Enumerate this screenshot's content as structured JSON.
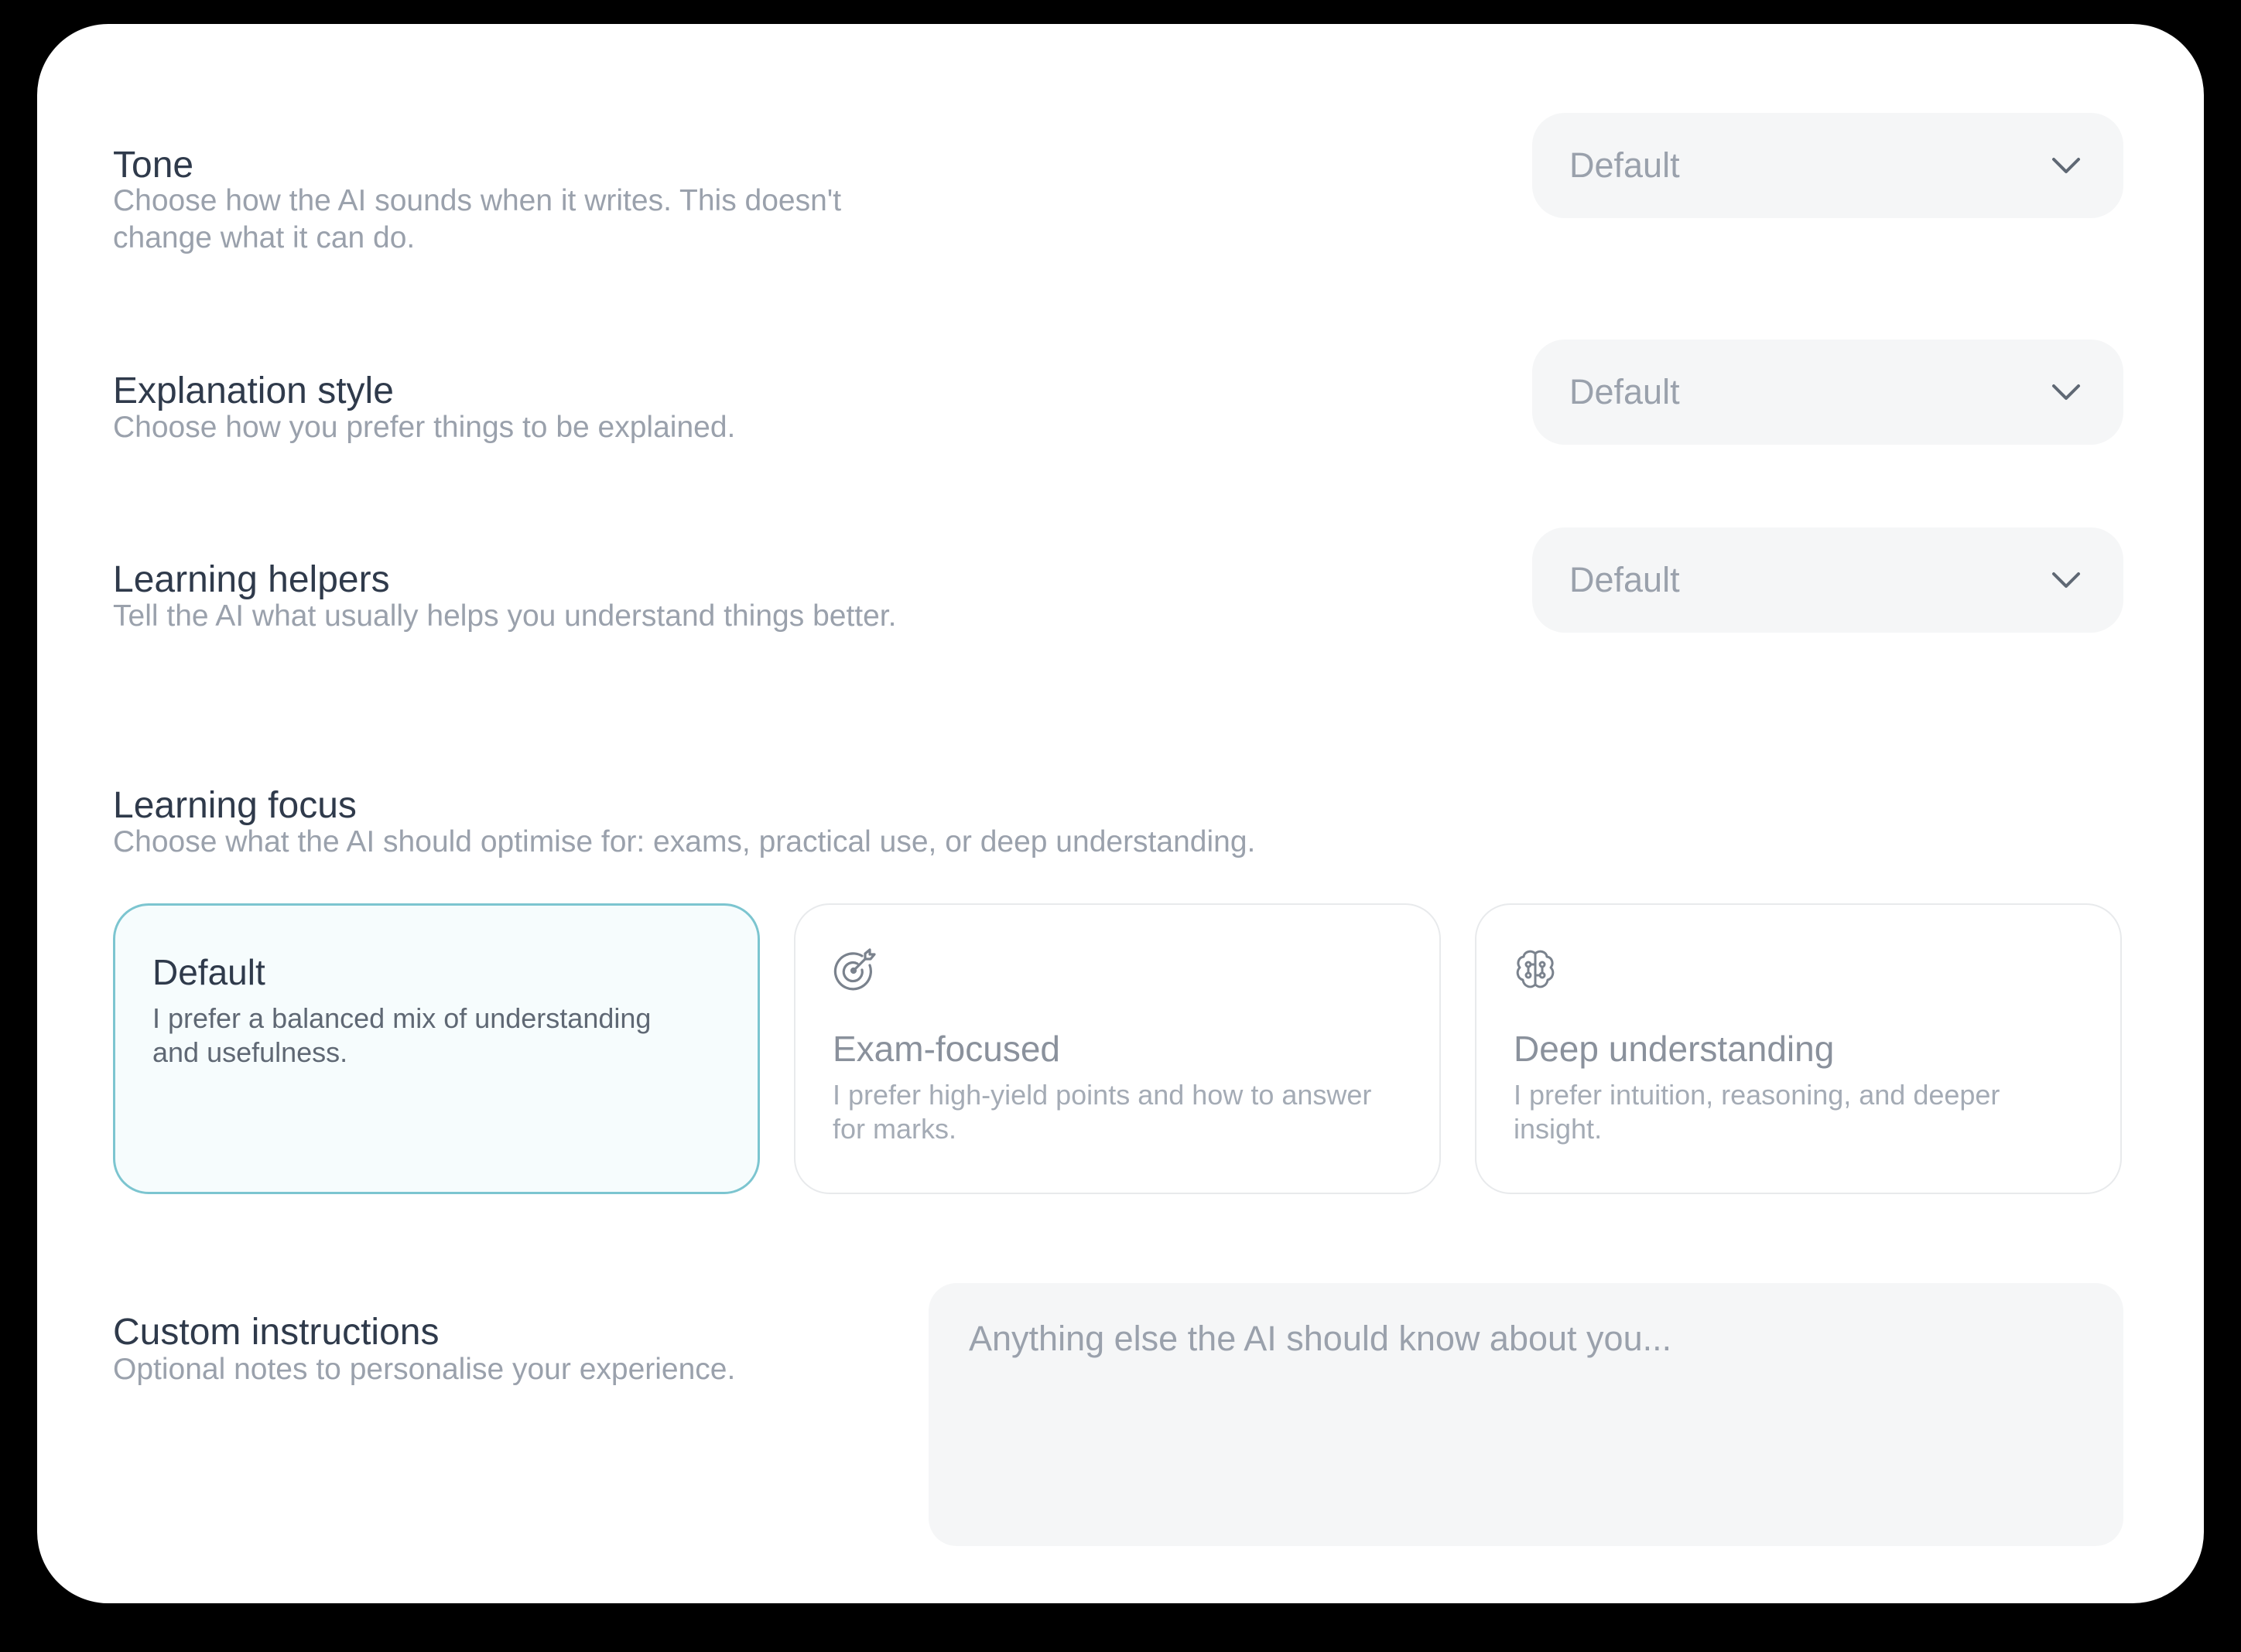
{
  "tone": {
    "title": "Tone",
    "description": "Choose how the AI sounds when it writes. This doesn't change what it can do.",
    "value": "Default"
  },
  "explanation_style": {
    "title": "Explanation style",
    "description": "Choose how you prefer things to be explained.",
    "value": "Default"
  },
  "learning_helpers": {
    "title": "Learning helpers",
    "description": "Tell the AI what usually helps you understand things better.",
    "value": "Default"
  },
  "learning_focus": {
    "title": "Learning focus",
    "description": "Choose what the AI should optimise for: exams, practical use, or deep understanding.",
    "selected": "Default",
    "options": [
      {
        "title": "Default",
        "description": "I prefer a balanced mix of understanding and usefulness.",
        "icon": "none"
      },
      {
        "title": "Exam-focused",
        "description": "I prefer high-yield points and how to answer for marks.",
        "icon": "target-icon"
      },
      {
        "title": "Deep understanding",
        "description": "I prefer intuition, reasoning, and deeper insight.",
        "icon": "brain-icon"
      }
    ]
  },
  "custom_instructions": {
    "title": "Custom instructions",
    "description": "Optional notes to personalise your experience.",
    "placeholder": "Anything else the AI should know about you..."
  },
  "colors": {
    "selected_border": "#7cc5d0",
    "selected_bg": "#f6fcfd",
    "field_bg": "#f5f6f7",
    "heading": "#2f3a4b",
    "muted": "#9aa1ac"
  }
}
